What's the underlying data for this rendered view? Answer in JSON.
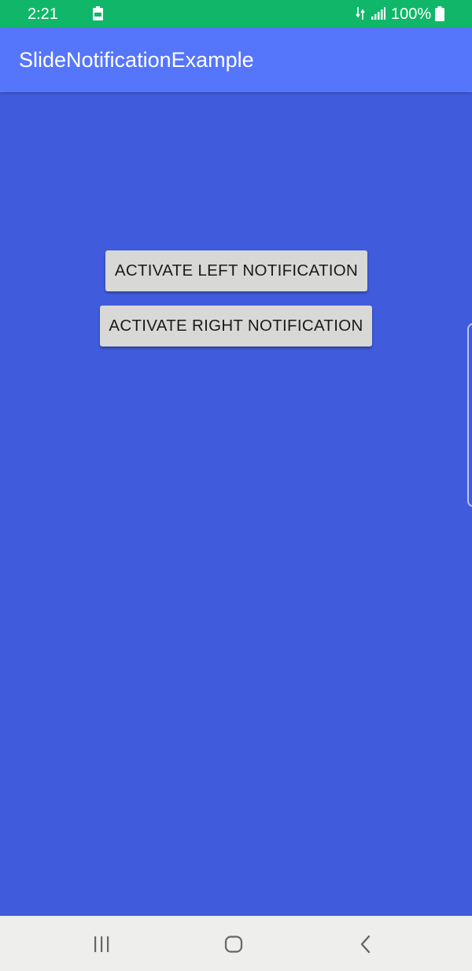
{
  "status_bar": {
    "time": "2:21",
    "battery_percent": "100%",
    "color": "#11b769",
    "icons": [
      "battery-notification-icon",
      "data-transfer-icon",
      "signal-icon",
      "battery-icon"
    ]
  },
  "app_bar": {
    "title": "SlideNotificationExample",
    "color": "#5576fb"
  },
  "main": {
    "background": "#405cdc",
    "buttons": [
      {
        "label": "ACTIVATE LEFT NOTIFICATION"
      },
      {
        "label": "ACTIVATE RIGHT NOTIFICATION"
      }
    ]
  },
  "nav_bar": {
    "icons": [
      "recents-icon",
      "home-icon",
      "back-icon"
    ]
  }
}
